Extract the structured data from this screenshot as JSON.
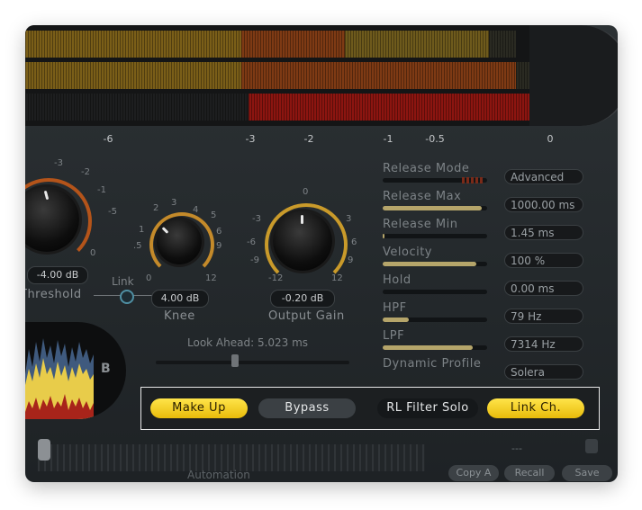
{
  "meter_scale": [
    "-6",
    "-3",
    "-2",
    "-1",
    "-0.5",
    "0"
  ],
  "knobs": {
    "threshold": {
      "value": "-4.00 dB",
      "label": "Threshold",
      "min": "0",
      "marks": [
        "-3",
        "-2",
        "-1",
        "-5"
      ]
    },
    "knee": {
      "value": "4.00 dB",
      "label": "Knee",
      "min": "0",
      "max": "12",
      "marks": [
        "2",
        "3",
        "1",
        "5",
        "4",
        ".5",
        "6",
        "9"
      ]
    },
    "output_gain": {
      "value": "-0.20 dB",
      "label": "Output Gain",
      "min": "-12",
      "max": "12",
      "top": "0",
      "marks": [
        "-3",
        "3",
        "-6",
        "6",
        "-9",
        "9"
      ]
    },
    "link_label": "Link"
  },
  "params": [
    {
      "label": "Release Mode",
      "value": "Advanced",
      "fill": null
    },
    {
      "label": "Release Max",
      "value": "1000.00 ms",
      "fill": 0.95
    },
    {
      "label": "Release Min",
      "value": "1.45 ms",
      "fill": 0.02
    },
    {
      "label": "Velocity",
      "value": "100 %",
      "fill": 0.9
    },
    {
      "label": "Hold",
      "value": "0.00 ms",
      "fill": 0.0
    },
    {
      "label": "HPF",
      "value": "79 Hz",
      "fill": 0.25
    },
    {
      "label": "LPF",
      "value": "7314 Hz",
      "fill": 0.86
    },
    {
      "label": "Dynamic Profile",
      "value": "Solera",
      "fill": null
    }
  ],
  "lookahead": {
    "label": "Look Ahead: 5.023 ms",
    "fraction": 0.4
  },
  "scope": {
    "badge": "B"
  },
  "buttons": {
    "make_up": "Make Up",
    "bypass": "Bypass",
    "rl_filter_solo": "RL Filter Solo",
    "link_ch": "Link Ch."
  },
  "bottom": {
    "automation": "Automation",
    "preset_value": "---",
    "copy": "Copy A",
    "recall": "Recall",
    "save": "Save"
  },
  "colors": {
    "accent_yellow": "#f2c81a",
    "meter_amber": "#8a6a1a",
    "meter_red": "#9a1810"
  }
}
